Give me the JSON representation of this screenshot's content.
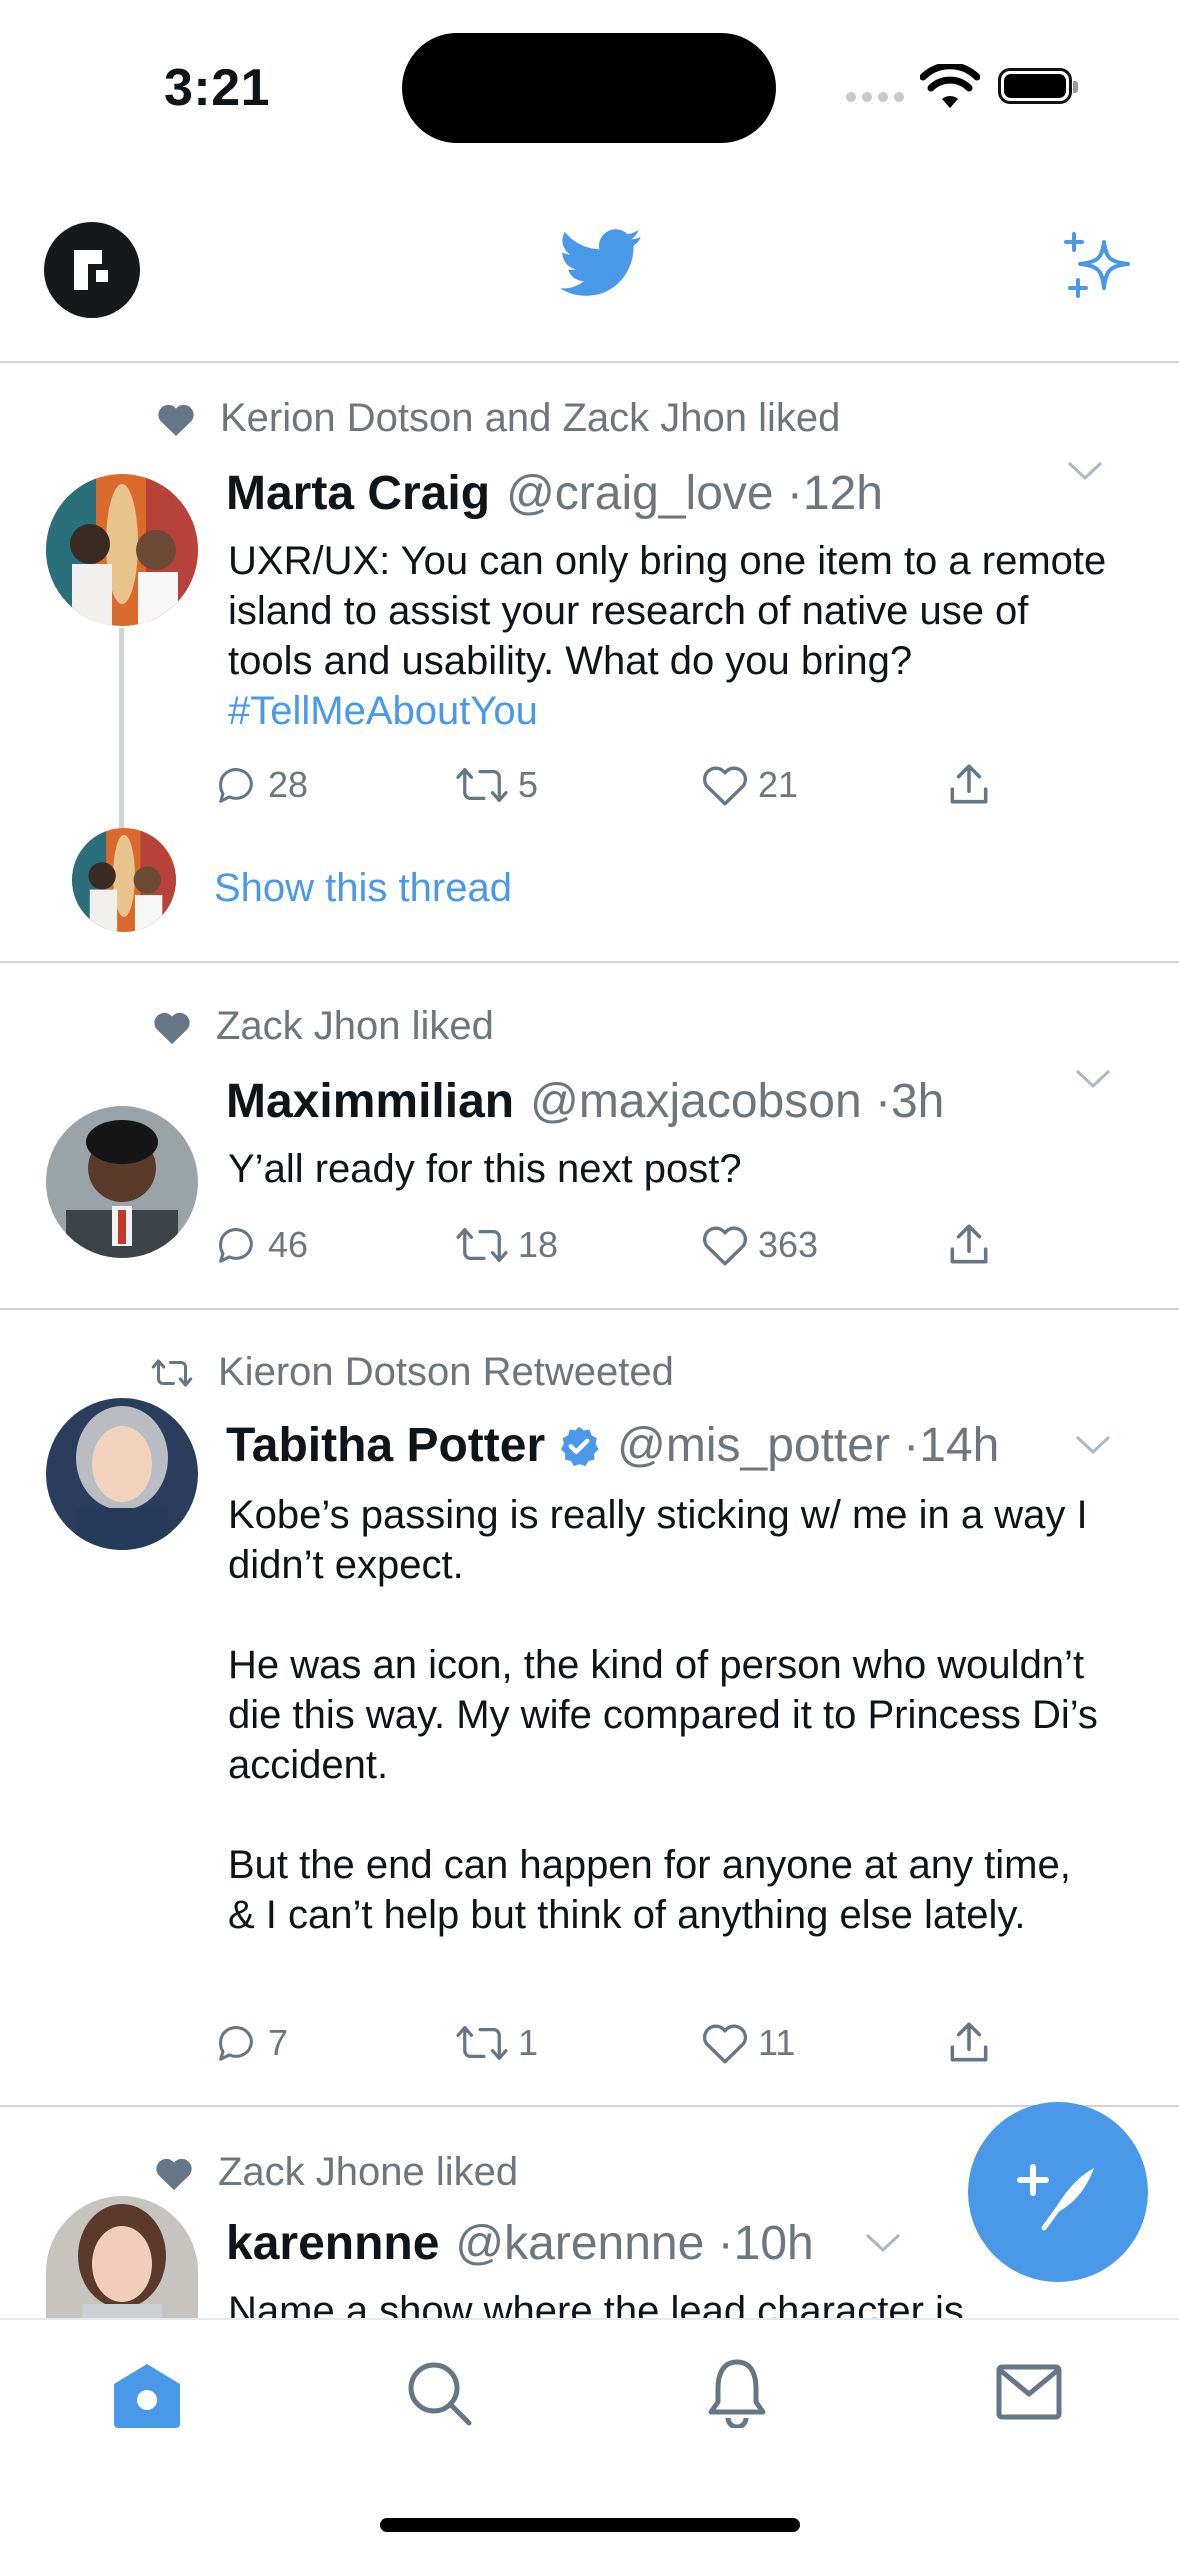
{
  "status_bar": {
    "time": "3:21"
  },
  "colors": {
    "accent": "#4a99e9",
    "text": "#0f1419",
    "secondary": "#6e767d",
    "divider": "#cfd4d9",
    "verified": "#4a99e9"
  },
  "icons": {
    "header_left": "app-logo-icon",
    "header_center": "twitter-bird-icon",
    "header_right": "sparkle-icon"
  },
  "tweets": [
    {
      "social": "Kerion Dotson and Zack Jhon liked",
      "social_icon": "heart-icon",
      "name": "Marta Craig",
      "handle": "@craig_love ·12h",
      "text": "UXR/UX: You can only bring one item to a remote island to assist your research of native use of tools and usability. What do you bring?",
      "hashtag": "#TellMeAboutYou",
      "replies": "28",
      "retweets": "5",
      "likes": "21",
      "thread": "Show this thread"
    },
    {
      "social": "Zack Jhon liked",
      "social_icon": "heart-icon",
      "name": "Maximmilian",
      "handle": "@maxjacobson ·3h",
      "text": "Y’all ready for this next post?",
      "replies": "46",
      "retweets": "18",
      "likes": "363"
    },
    {
      "social": "Kieron Dotson Retweeted",
      "social_icon": "retweet-icon",
      "name": "Tabitha Potter",
      "verified": true,
      "handle": "@mis_potter ·14h",
      "text_p1": "Kobe’s passing is really sticking w/ me in a way I didn’t expect.",
      "text_p2": "He was an icon, the kind of person who wouldn’t die this way. My wife compared it to Princess Di’s accident.",
      "text_p3": "But the end can happen for anyone at any time, & I can’t help but think of anything else lately.",
      "replies": "7",
      "retweets": "1",
      "likes": "11"
    },
    {
      "social": "Zack Jhone liked",
      "social_icon": "heart-icon",
      "name": "karennne",
      "handle": "@karennne ·10h",
      "text": "Name a show where the lead character is"
    }
  ],
  "tabbar": [
    "home-icon",
    "search-icon",
    "notifications-icon",
    "messages-icon"
  ]
}
